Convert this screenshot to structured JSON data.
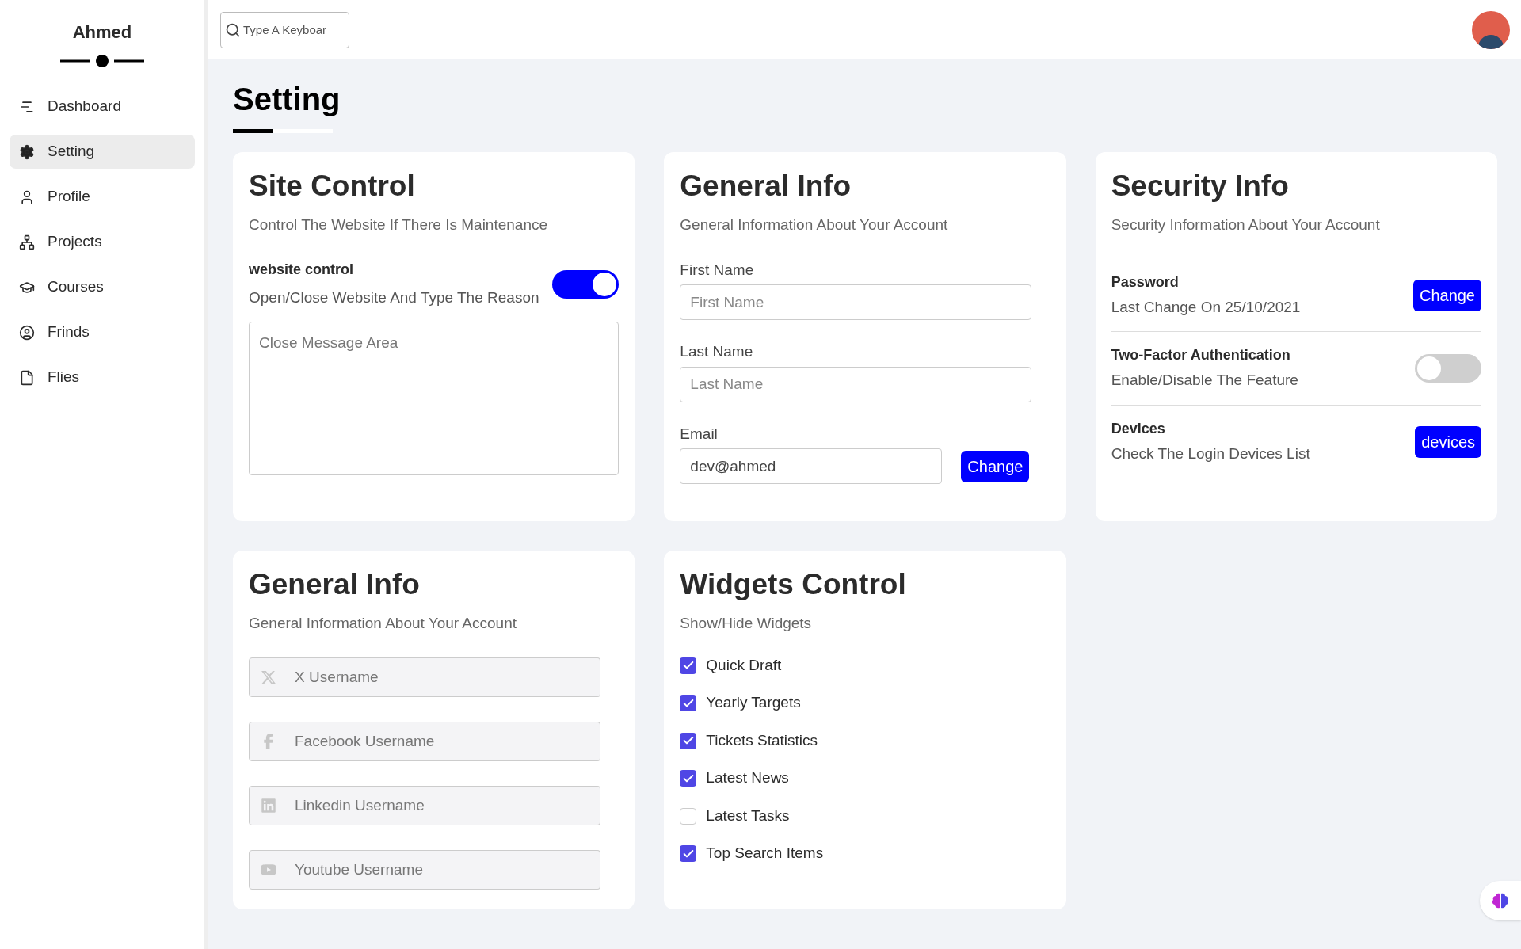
{
  "sidebar": {
    "title": "Ahmed",
    "items": [
      {
        "label": "Dashboard",
        "selected": false
      },
      {
        "label": "Setting",
        "selected": true
      },
      {
        "label": "Profile",
        "selected": false
      },
      {
        "label": "Projects",
        "selected": false
      },
      {
        "label": "Courses",
        "selected": false
      },
      {
        "label": "Frinds",
        "selected": false
      },
      {
        "label": "Flies",
        "selected": false
      }
    ]
  },
  "header": {
    "search": {
      "placeholder": "Type A Keyboar"
    }
  },
  "page_title": "Setting",
  "site_control": {
    "title": "Site Control",
    "subtitle": "Control The Website If There Is Maintenance",
    "label": "website control",
    "description": "Open/Close Website And Type The Reason",
    "on": true,
    "message": {
      "placeholder": "Close Message Area"
    }
  },
  "general_info": {
    "title": "General Info",
    "subtitle": "General Information About Your Account",
    "fields": [
      {
        "label": "First Name",
        "placeholder": "First Name"
      },
      {
        "label": "Last Name",
        "placeholder": "Last Name"
      },
      {
        "label": "Email",
        "value": "dev@ahmed",
        "button": "Change"
      }
    ]
  },
  "security_info": {
    "title": "Security Info",
    "subtitle": "Security Information About Your Account",
    "rows": [
      {
        "kind": "button",
        "title": "Password",
        "description": "Last Change On 25/10/2021",
        "button": "Change"
      },
      {
        "kind": "toggle",
        "title": "Two-Factor Authentication",
        "description": "Enable/Disable The Feature",
        "on": false
      },
      {
        "kind": "button",
        "title": "Devices",
        "description": "Check The Login Devices List",
        "button": "devices"
      }
    ]
  },
  "social_info": {
    "title": "General Info",
    "subtitle": "General Information About Your Account",
    "fields": [
      {
        "placeholder": "X Username"
      },
      {
        "placeholder": "Facebook Username"
      },
      {
        "placeholder": "Linkedin Username"
      },
      {
        "placeholder": "Youtube Username"
      }
    ]
  },
  "widgets_control": {
    "title": "Widgets Control",
    "subtitle": "Show/Hide Widgets",
    "items": [
      {
        "label": "Quick Draft",
        "checked": true
      },
      {
        "label": "Yearly Targets",
        "checked": true
      },
      {
        "label": "Tickets Statistics",
        "checked": true
      },
      {
        "label": "Latest News",
        "checked": true
      },
      {
        "label": "Latest Tasks",
        "checked": false
      },
      {
        "label": "Top Search Items",
        "checked": true
      }
    ]
  }
}
